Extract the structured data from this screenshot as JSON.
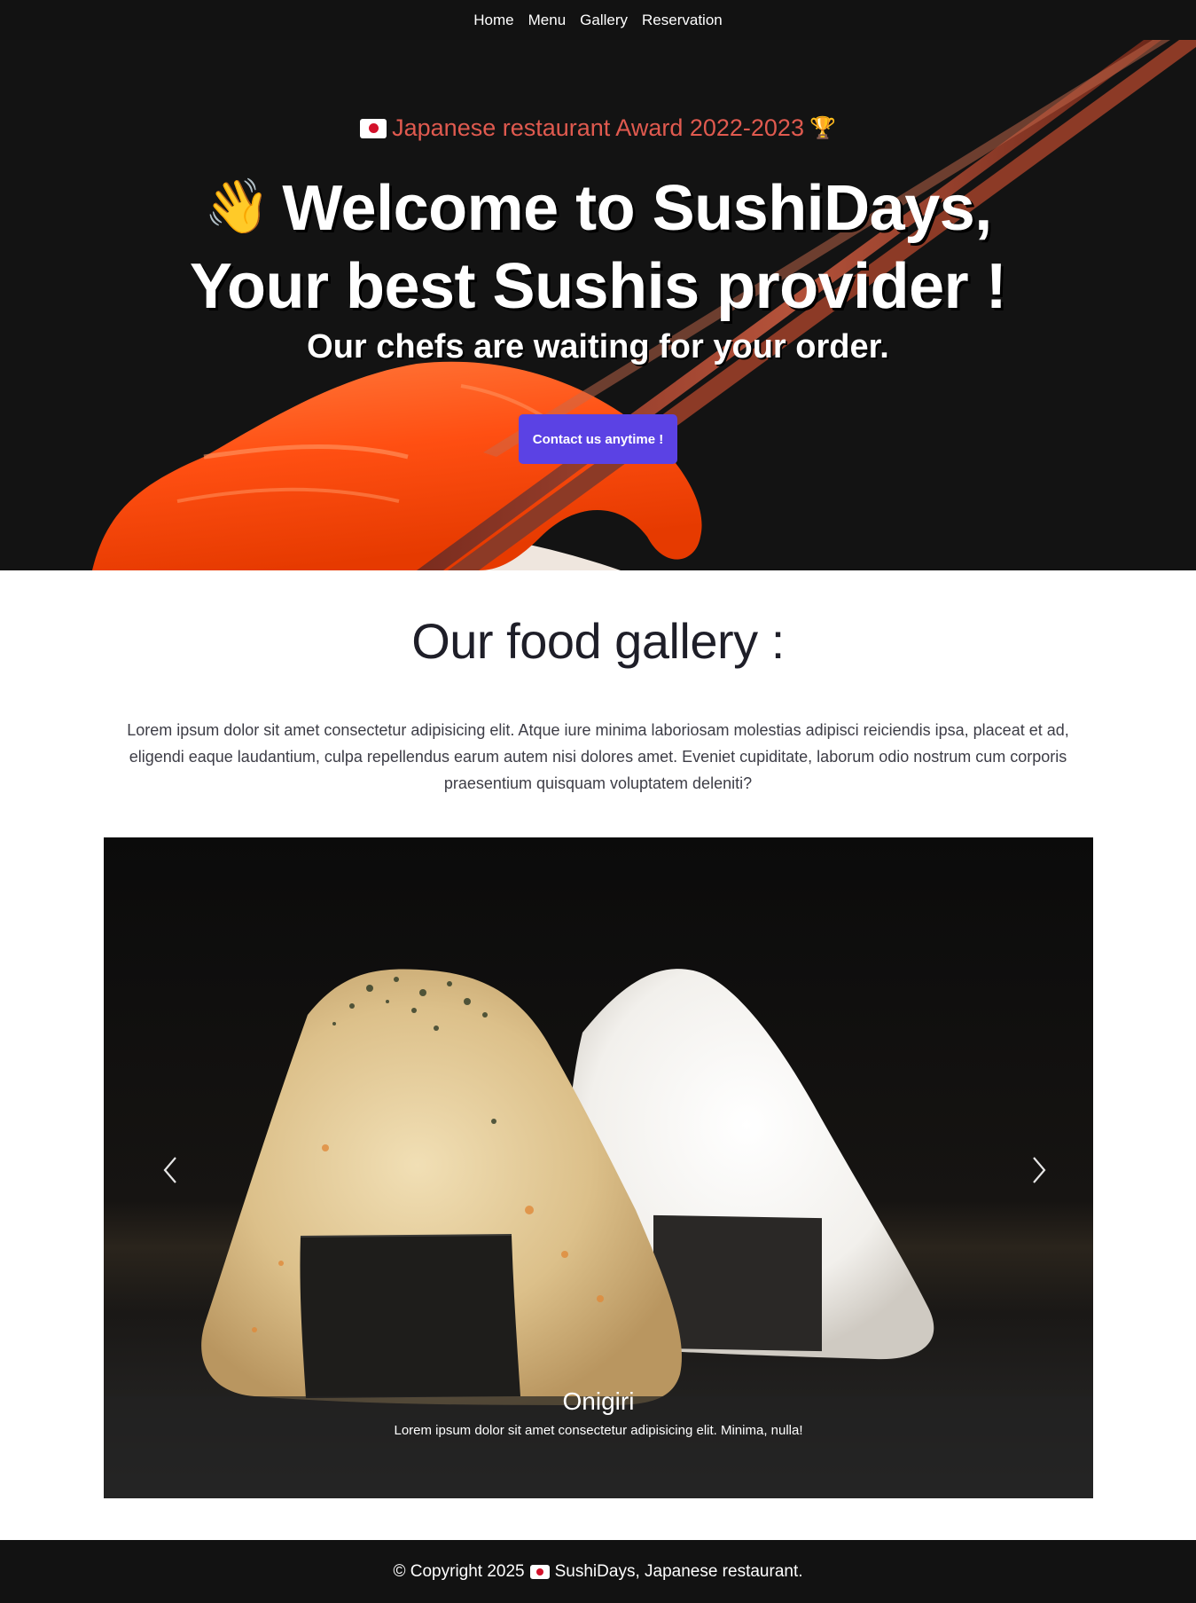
{
  "nav": {
    "items": [
      {
        "label": "Home"
      },
      {
        "label": "Menu"
      },
      {
        "label": "Gallery"
      },
      {
        "label": "Reservation"
      }
    ]
  },
  "hero": {
    "award": "Japanese restaurant Award 2022-2023",
    "headline": "Welcome to SushiDays, Your best Sushis provider !",
    "subline": "Our chefs are waiting for your order.",
    "cta_label": "Contact us anytime !",
    "icons": {
      "flag": "japan-flag-icon",
      "trophy": "trophy-icon",
      "wave": "waving-hand-icon"
    }
  },
  "gallery": {
    "title": "Our food gallery :",
    "description": "Lorem ipsum dolor sit amet consectetur adipisicing elit. Atque iure minima laboriosam molestias adipisci reiciendis ipsa, placeat et ad, eligendi eaque laudantium, culpa repellendus earum autem nisi dolores amet. Eveniet cupiditate, laborum odio nostrum cum corporis praesentium quisquam voluptatem deleniti?",
    "slide": {
      "title": "Onigiri",
      "text": "Lorem ipsum dolor sit amet consectetur adipisicing elit. Minima, nulla!"
    }
  },
  "footer": {
    "copyright": "© Copyright 2025",
    "name": "SushiDays, Japanese restaurant."
  },
  "colors": {
    "dark_bg": "#121212",
    "accent_button": "#5b42e4",
    "award_text": "#e05a4f",
    "salmon": "#ff5a1f"
  }
}
